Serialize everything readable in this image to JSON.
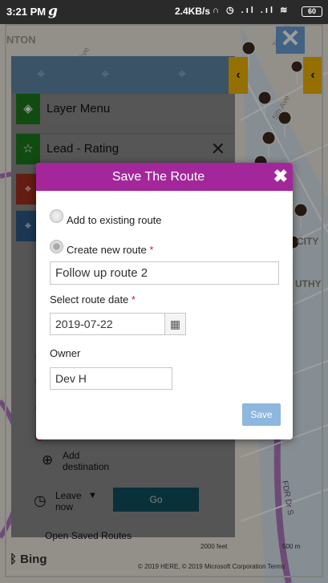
{
  "statusbar": {
    "time": "3:21 PM",
    "speed": "2.4KB/s",
    "icons": "∩ ◷ .ıl .ıl ≋",
    "battery": "60"
  },
  "map": {
    "close_icon": "✕",
    "collapse_icon": "‹",
    "tool_icons": [
      "⌖",
      "⌖",
      "⌖"
    ],
    "street_labels": [
      "NTON",
      "9th Ave",
      "7th Ave",
      "5th Ave",
      "CITY",
      "UTHY",
      "FDR Dr S"
    ],
    "bing": "Bing",
    "copyright": "© 2019 HERE, © 2019 Microsoft Corporation  Terms",
    "scale_feet": "2000 feet",
    "scale_m": "500 m"
  },
  "panel": {
    "layer_menu": "Layer Menu",
    "lead_rating": "Lead - Rating",
    "add_destination": "Add destination",
    "leave_now": "Leave now",
    "go": "Go",
    "open_saved": "Open Saved Routes"
  },
  "modal": {
    "title": "Save The Route",
    "close_icon": "✖",
    "add_existing_label": "Add to existing route",
    "create_new_label": "Create new route",
    "required_mark": "*",
    "route_name_value": "Follow up route 2",
    "date_label": "Select route date",
    "date_value": "2019-07-22",
    "calendar_icon": "▦",
    "owner_label": "Owner",
    "owner_value": "Dev H",
    "save_label": "Save"
  },
  "colors": {
    "modal_header": "#a3279b",
    "save_button": "#8eb7de",
    "collapse_button": "#f0b400",
    "go_button": "#0f4f5e"
  }
}
